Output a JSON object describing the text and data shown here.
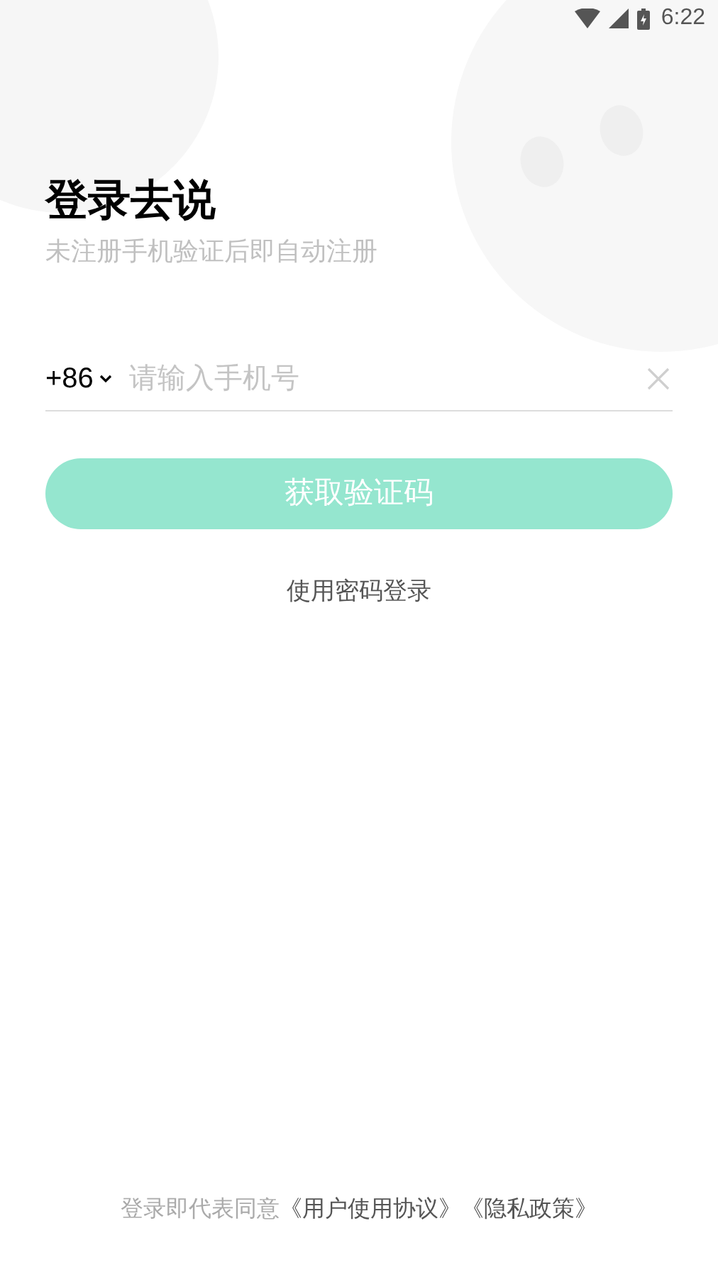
{
  "status_bar": {
    "time": "6:22"
  },
  "title": "登录去说",
  "subtitle": "未注册手机验证后即自动注册",
  "phone_field": {
    "country_code": "+86",
    "placeholder": "请输入手机号"
  },
  "get_code_button": {
    "label": "获取验证码",
    "disabled": true
  },
  "password_login_link": "使用密码登录",
  "agreement": {
    "prefix": "登录即代表同意",
    "links": [
      "《用户使用协议》",
      "《隐私政策》"
    ]
  }
}
